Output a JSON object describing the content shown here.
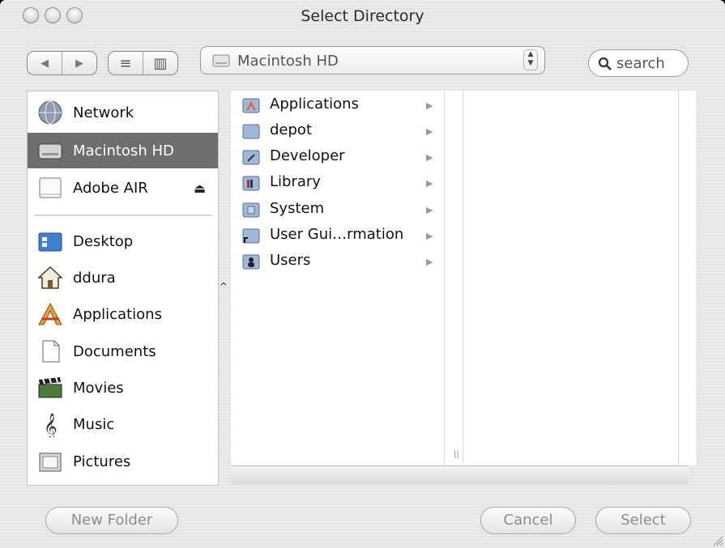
{
  "window": {
    "title": "Select Directory"
  },
  "toolbar": {
    "back_label": "◀",
    "forward_label": "▶",
    "list_view_label": "≡",
    "column_view_label": "▥",
    "location_popup": "Macintosh HD",
    "search_placeholder": "search"
  },
  "sidebar": {
    "devices": [
      {
        "label": "Network",
        "icon": "globe-icon"
      },
      {
        "label": "Macintosh HD",
        "icon": "hard-drive-icon",
        "selected": true
      },
      {
        "label": "Adobe AIR",
        "icon": "disk-image-icon",
        "eject": "⏏"
      }
    ],
    "places": [
      {
        "label": "Desktop",
        "icon": "desktop-folder-icon"
      },
      {
        "label": "ddura",
        "icon": "home-icon"
      },
      {
        "label": "Applications",
        "icon": "applications-icon"
      },
      {
        "label": "Documents",
        "icon": "document-icon"
      },
      {
        "label": "Movies",
        "icon": "film-icon"
      },
      {
        "label": "Music",
        "icon": "music-note-icon"
      },
      {
        "label": "Pictures",
        "icon": "picture-frame-icon"
      }
    ]
  },
  "browser": {
    "column1": [
      {
        "label": "Applications",
        "icon": "applications-folder-icon"
      },
      {
        "label": "depot",
        "icon": "folder-icon"
      },
      {
        "label": "Developer",
        "icon": "developer-folder-icon"
      },
      {
        "label": "Library",
        "icon": "library-folder-icon"
      },
      {
        "label": "System",
        "icon": "system-folder-icon"
      },
      {
        "label": "User Gui…rmation",
        "icon": "alias-folder-icon"
      },
      {
        "label": "Users",
        "icon": "users-folder-icon"
      }
    ],
    "arrow": "▶",
    "grip": "||"
  },
  "footer": {
    "new_folder_label": "New Folder",
    "cancel_label": "Cancel",
    "select_label": "Select"
  },
  "colors": {
    "sidebar_selection": "#6e6e6e",
    "window_bg": "#ececec"
  }
}
